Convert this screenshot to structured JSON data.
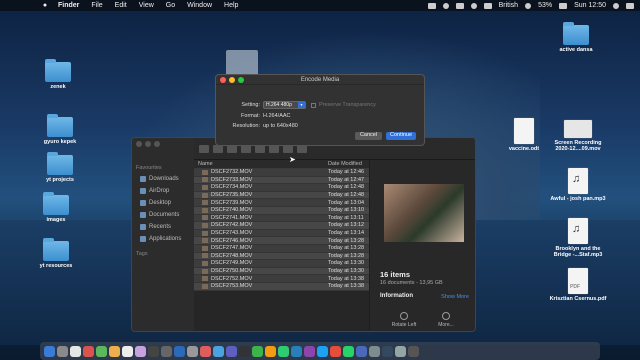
{
  "menubar": {
    "apple": "",
    "app": "Finder",
    "items": [
      "File",
      "Edit",
      "View",
      "Go",
      "Window",
      "Help"
    ],
    "input_source": "British",
    "battery": "53%",
    "clock": "Sun 12:50"
  },
  "desktop_icons": {
    "zenek": "zenek",
    "gyuro": "gyuro kepek",
    "yt_projects": "yt projects",
    "images": "images",
    "yt_resources": "yt resources",
    "active_dansa": "active dansa",
    "vaccine": "vaccine.odt",
    "screen_recording": "Screen Recording 2020-12....09.mov",
    "awful": "Awful - josh pan.mp3",
    "brooklyn": "Brooklyn and the Bridge -...Staf.mp3",
    "krisztian": "Krisztian Csernus.pdf"
  },
  "finder": {
    "sidebar_heading": "Favourites",
    "sidebar_items": [
      "Downloads",
      "AirDrop",
      "Desktop",
      "Documents",
      "Recents",
      "Applications"
    ],
    "tags_heading": "Tags",
    "columns": {
      "name": "Name",
      "date": "Date Modified"
    },
    "files": [
      {
        "name": "DSCF2732.MOV",
        "date": "Today at 12:46"
      },
      {
        "name": "DSCF2733.MOV",
        "date": "Today at 12:47"
      },
      {
        "name": "DSCF2734.MOV",
        "date": "Today at 12:48"
      },
      {
        "name": "DSCF2735.MOV",
        "date": "Today at 12:48"
      },
      {
        "name": "DSCF2739.MOV",
        "date": "Today at 13:04"
      },
      {
        "name": "DSCF2740.MOV",
        "date": "Today at 13:10"
      },
      {
        "name": "DSCF2741.MOV",
        "date": "Today at 13:11"
      },
      {
        "name": "DSCF2742.MOV",
        "date": "Today at 13:12"
      },
      {
        "name": "DSCF2743.MOV",
        "date": "Today at 13:14"
      },
      {
        "name": "DSCF2746.MOV",
        "date": "Today at 13:28"
      },
      {
        "name": "DSCF2747.MOV",
        "date": "Today at 13:28"
      },
      {
        "name": "DSCF2748.MOV",
        "date": "Today at 13:28"
      },
      {
        "name": "DSCF2749.MOV",
        "date": "Today at 13:30"
      },
      {
        "name": "DSCF2750.MOV",
        "date": "Today at 13:30"
      },
      {
        "name": "DSCF2752.MOV",
        "date": "Today at 13:38"
      },
      {
        "name": "DSCF2753.MOV",
        "date": "Today at 13:38"
      }
    ],
    "preview": {
      "count": "16 items",
      "subtitle": "16 documents - 13,95 GB",
      "info_label": "Information",
      "show_more": "Show More",
      "rotate": "Rotate Left",
      "more": "More..."
    }
  },
  "dialog": {
    "title": "Encode Media",
    "setting_label": "Setting:",
    "setting_value": "H.264 480p",
    "preserve_label": "Preserve Transparency",
    "format_label": "Format:",
    "format_value": "H.264/AAC",
    "resolution_label": "Resolution:",
    "resolution_value": "up to 640x480",
    "cancel": "Cancel",
    "continue": "Continue"
  },
  "colors": {
    "accent": "#2f6fd6",
    "close": "#ff5f57",
    "minimize": "#febc2e",
    "zoom": "#28c840"
  }
}
